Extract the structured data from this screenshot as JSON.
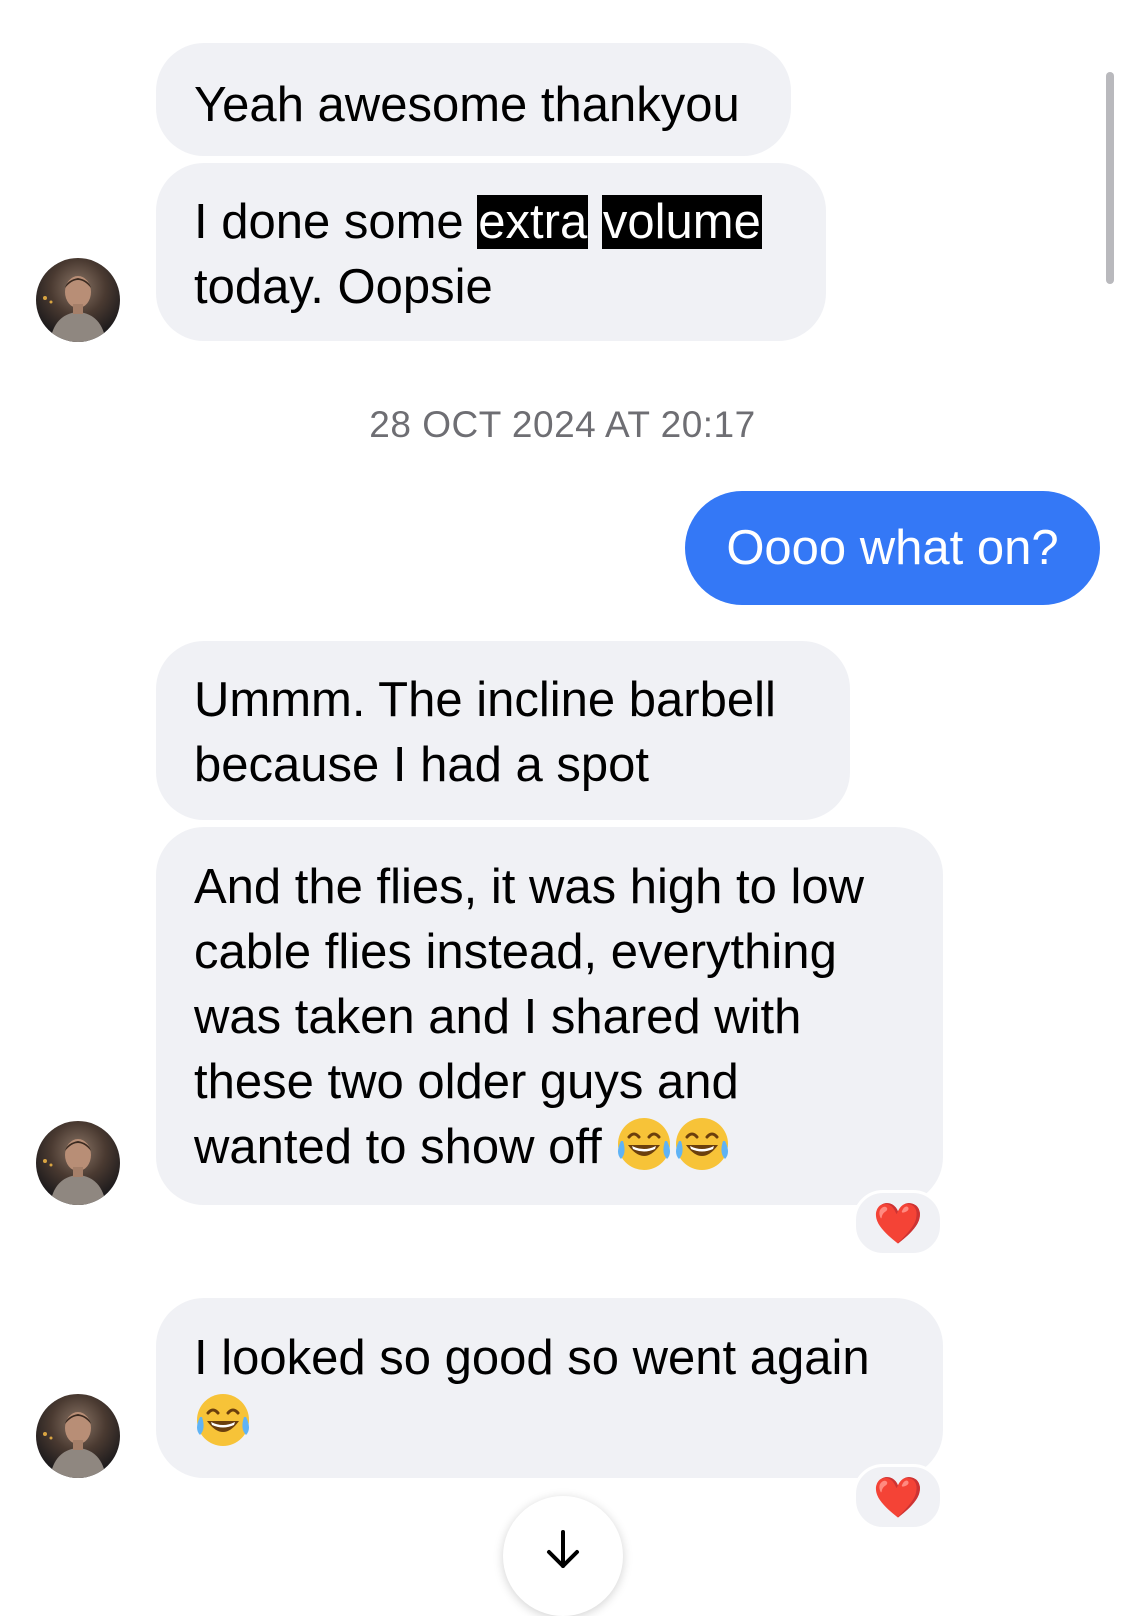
{
  "messages": [
    {
      "sender": "other",
      "text": "Yeah awesome thankyou"
    },
    {
      "sender": "other",
      "text_before": "I done some",
      "highlight_1": "extra",
      "highlight_2": "volume",
      "text_line2": "today. Oopsie"
    },
    {
      "sender": "me",
      "text": "Oooo what on?"
    },
    {
      "sender": "other",
      "lines": [
        "Ummm. The incline barbell",
        "because I had a spot"
      ]
    },
    {
      "sender": "other",
      "lines": [
        "And the flies, it was high to low",
        "cable flies instead, everything",
        "was taken and I shared with",
        "these two older guys and",
        "wanted to show off"
      ],
      "emoji": "face-with-tears-of-joy x2",
      "reaction": "❤️"
    },
    {
      "sender": "other",
      "lines": [
        "I looked so good so went again"
      ],
      "emoji": "face-with-tears-of-joy",
      "reaction": "❤️"
    }
  ],
  "timestamp": "28 OCT 2024 AT 20:17",
  "colors": {
    "incoming_bubble": "#f0f1f5",
    "outgoing_bubble": "#3478f6",
    "timestamp_text": "#6e6e73",
    "reaction_heart": "#e0232e"
  },
  "icons": {
    "scroll_down": "arrow-down-icon",
    "reaction": "heart-icon"
  }
}
